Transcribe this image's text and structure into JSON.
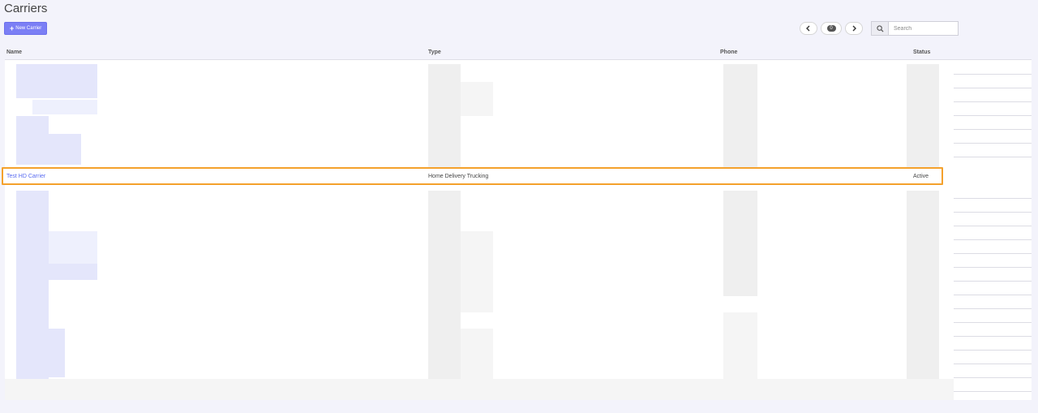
{
  "page": {
    "title": "Carriers"
  },
  "toolbar": {
    "new_label": "New Carrier",
    "page_count": "0"
  },
  "search": {
    "placeholder": "Search"
  },
  "table": {
    "columns": [
      "Name",
      "Type",
      "Phone",
      "Status"
    ],
    "highlighted_row": {
      "name": "Test HD Carrier",
      "type": "Home Delivery Trucking",
      "phone": "",
      "status": "Active"
    }
  },
  "colors": {
    "accent": "#7b7ff5",
    "link": "#5a6cf0",
    "highlight": "#f4a12c"
  },
  "icons": [
    "plus-icon",
    "chevron-left-icon",
    "chevron-right-icon",
    "search-icon"
  ]
}
